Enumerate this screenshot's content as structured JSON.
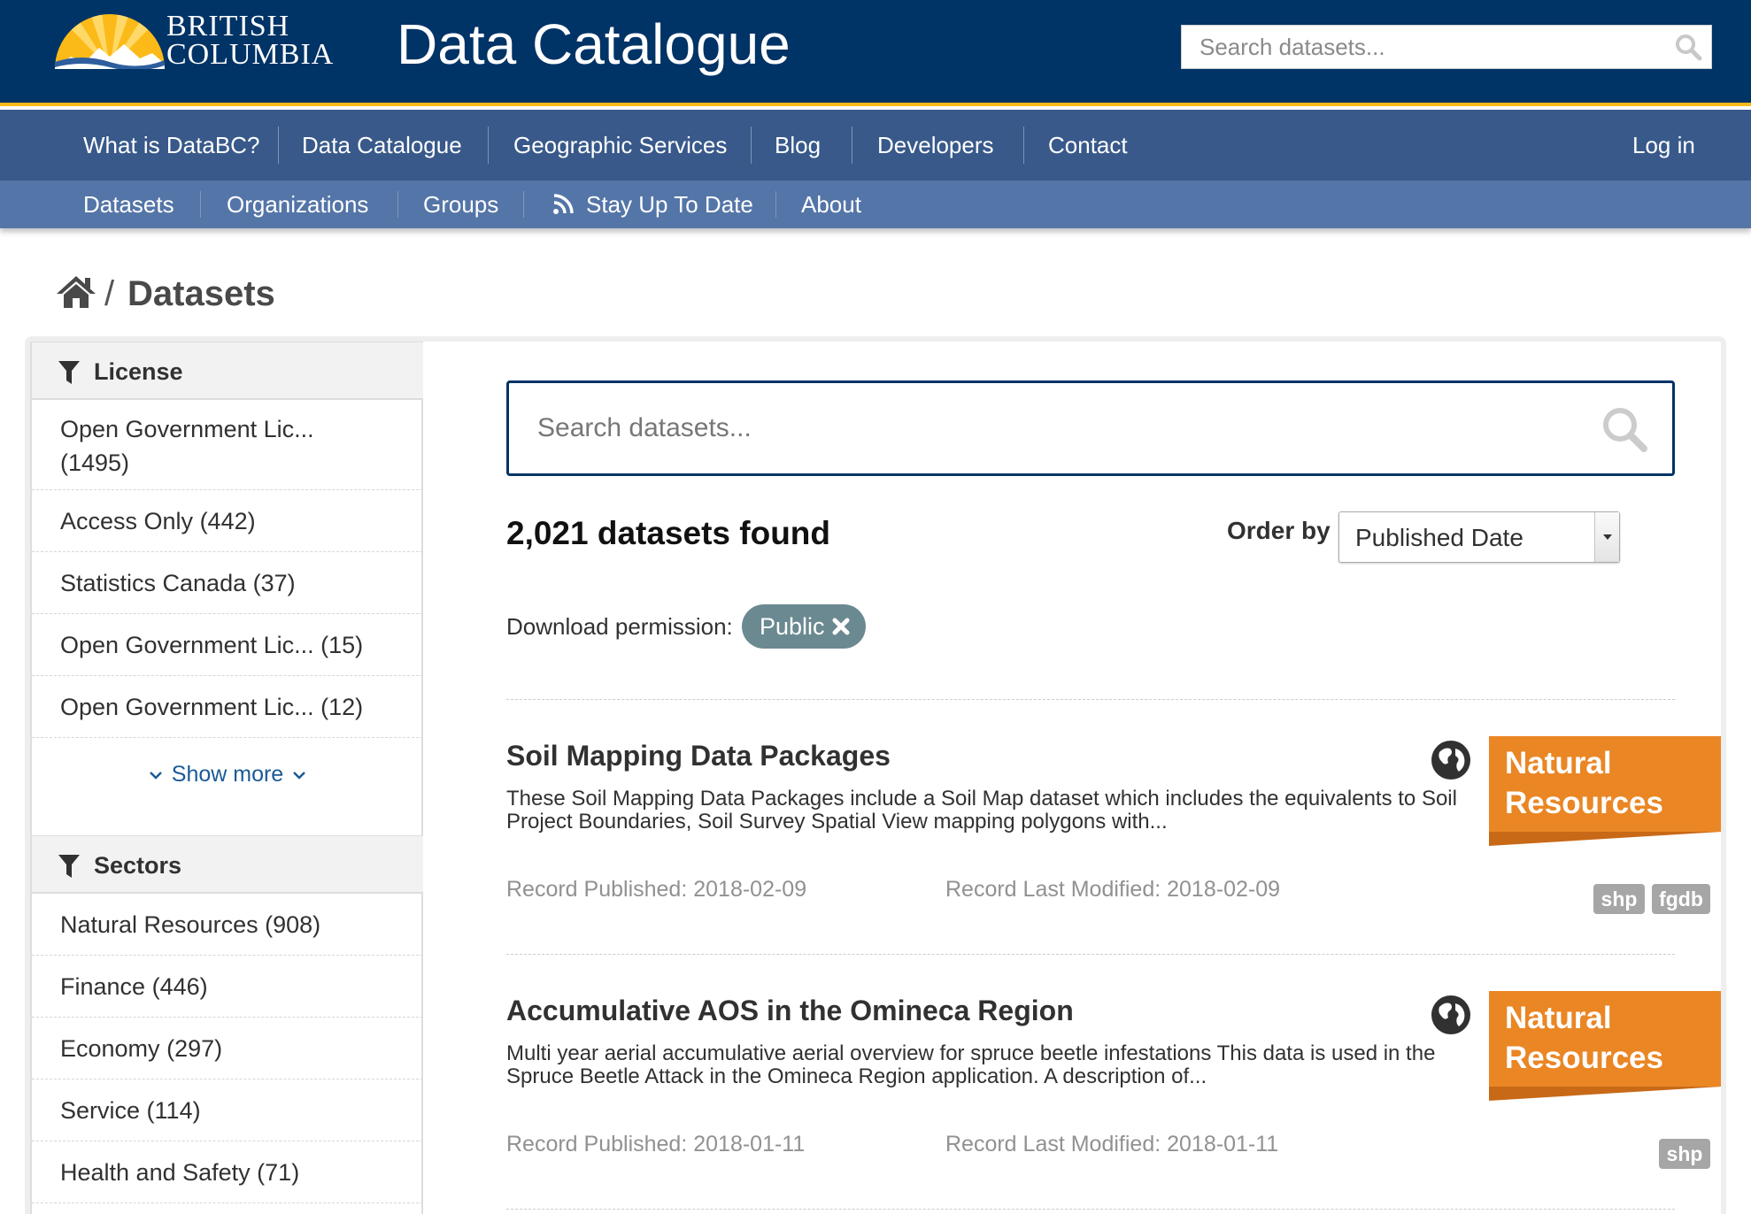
{
  "header": {
    "logo_line1": "BRITISH",
    "logo_line2": "COLUMBIA",
    "site_title": "Data Catalogue",
    "search_placeholder": "Search datasets..."
  },
  "main_nav": {
    "items": [
      "What is DataBC?",
      "Data Catalogue",
      "Geographic Services",
      "Blog",
      "Developers",
      "Contact"
    ],
    "login": "Log in"
  },
  "sub_nav": {
    "items": [
      "Datasets",
      "Organizations",
      "Groups",
      "Stay Up To Date",
      "About"
    ]
  },
  "breadcrumb": {
    "separator": "/",
    "current": "Datasets"
  },
  "sidebar": {
    "license": {
      "title": "License",
      "items": [
        {
          "label": "Open Government Lic...",
          "count": "(1495)"
        },
        {
          "label": "Access Only",
          "count": "(442)"
        },
        {
          "label": "Statistics Canada",
          "count": "(37)"
        },
        {
          "label": "Open Government Lic...",
          "count": "(15)"
        },
        {
          "label": "Open Government Lic...",
          "count": "(12)"
        }
      ],
      "show_more": "Show more"
    },
    "sectors": {
      "title": "Sectors",
      "items": [
        {
          "label": "Natural Resources",
          "count": "(908)"
        },
        {
          "label": "Finance",
          "count": "(446)"
        },
        {
          "label": "Economy",
          "count": "(297)"
        },
        {
          "label": "Service",
          "count": "(114)"
        },
        {
          "label": "Health and Safety",
          "count": "(71)"
        }
      ]
    }
  },
  "search": {
    "placeholder": "Search datasets..."
  },
  "results": {
    "count_text": "2,021 datasets found",
    "order_label": "Order by",
    "order_value": "Published Date",
    "filter_label": "Download permission:",
    "filter_value": "Public"
  },
  "datasets": [
    {
      "title": "Soil Mapping Data Packages",
      "description": "These Soil Mapping Data Packages include a Soil Map dataset which includes the equivalents to Soil Project Boundaries, Soil Survey Spatial View mapping polygons with...",
      "published": "Record Published: 2018-02-09",
      "modified": "Record Last Modified: 2018-02-09",
      "sector": "Natural Resources",
      "formats": [
        "shp",
        "fgdb"
      ]
    },
    {
      "title": "Accumulative AOS in the Omineca Region",
      "description": "Multi year aerial accumulative aerial overview for spruce beetle infestations This data is used in the Spruce Beetle Attack in the Omineca Region application. A description of...",
      "published": "Record Published: 2018-01-11",
      "modified": "Record Last Modified: 2018-01-11",
      "sector": "Natural Resources",
      "formats": [
        "shp"
      ]
    }
  ],
  "colors": {
    "header_bg": "#003366",
    "gold_accent": "#fcba19",
    "main_nav_bg": "#38598a",
    "sub_nav_bg": "#5475a7",
    "sector_ribbon": "#ea8624",
    "format_badge": "#a6a6a6",
    "filter_pill": "#6b8991"
  },
  "icons": {
    "header_search": "search-icon",
    "rss": "rss-icon",
    "home": "home-icon",
    "facet": "filter-icon",
    "dataset_type": "globe-icon",
    "remove_filter": "close-icon"
  }
}
